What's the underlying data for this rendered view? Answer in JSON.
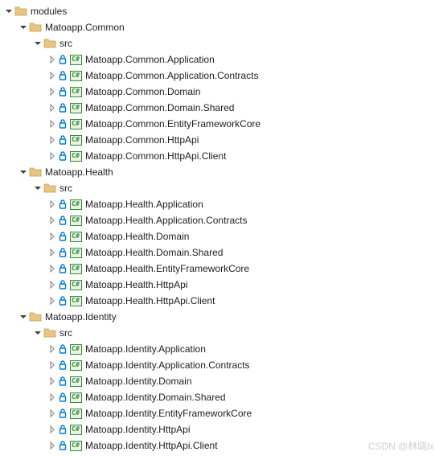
{
  "root": {
    "label": "modules"
  },
  "groups": [
    {
      "label": "Matoapp.Common",
      "src_label": "src",
      "projects": [
        {
          "label": "Matoapp.Common.Application"
        },
        {
          "label": "Matoapp.Common.Application.Contracts"
        },
        {
          "label": "Matoapp.Common.Domain"
        },
        {
          "label": "Matoapp.Common.Domain.Shared"
        },
        {
          "label": "Matoapp.Common.EntityFrameworkCore"
        },
        {
          "label": "Matoapp.Common.HttpApi"
        },
        {
          "label": "Matoapp.Common.HttpApi.Client"
        }
      ]
    },
    {
      "label": "Matoapp.Health",
      "src_label": "src",
      "projects": [
        {
          "label": "Matoapp.Health.Application"
        },
        {
          "label": "Matoapp.Health.Application.Contracts"
        },
        {
          "label": "Matoapp.Health.Domain"
        },
        {
          "label": "Matoapp.Health.Domain.Shared"
        },
        {
          "label": "Matoapp.Health.EntityFrameworkCore"
        },
        {
          "label": "Matoapp.Health.HttpApi"
        },
        {
          "label": "Matoapp.Health.HttpApi.Client"
        }
      ]
    },
    {
      "label": "Matoapp.Identity",
      "src_label": "src",
      "projects": [
        {
          "label": "Matoapp.Identity.Application"
        },
        {
          "label": "Matoapp.Identity.Application.Contracts"
        },
        {
          "label": "Matoapp.Identity.Domain"
        },
        {
          "label": "Matoapp.Identity.Domain.Shared"
        },
        {
          "label": "Matoapp.Identity.EntityFrameworkCore"
        },
        {
          "label": "Matoapp.Identity.HttpApi"
        },
        {
          "label": "Matoapp.Identity.HttpApi.Client"
        }
      ]
    }
  ],
  "watermark": "CSDN @林晓lx"
}
